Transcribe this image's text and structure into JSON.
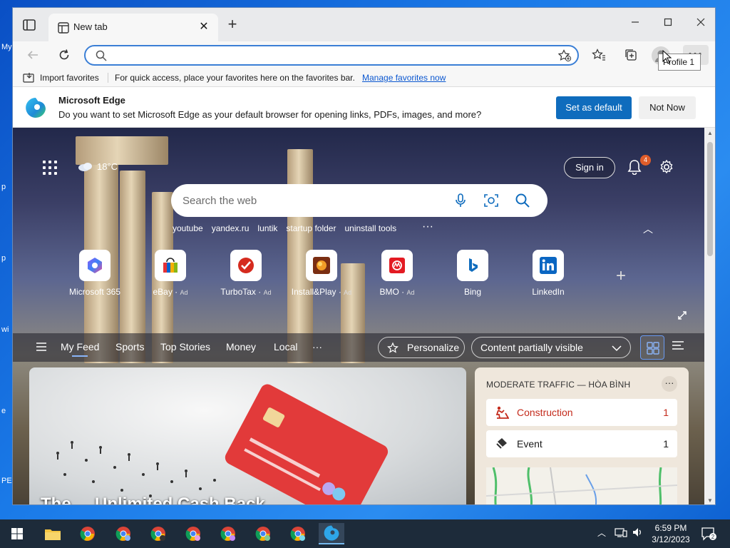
{
  "browser": {
    "tab_title": "New tab",
    "tooltip": "Profile 1"
  },
  "favorites_bar": {
    "import_label": "Import favorites",
    "hint": "For quick access, place your favorites here on the favorites bar.",
    "manage_link": "Manage favorites now"
  },
  "infobar": {
    "title": "Microsoft Edge",
    "message": "Do you want to set Microsoft Edge as your default browser for opening links, PDFs, images, and more?",
    "set_default": "Set as default",
    "not_now": "Not Now"
  },
  "newtab": {
    "weather": "18°C",
    "sign_in": "Sign in",
    "notif_count": "4",
    "search_placeholder": "Search the web",
    "trending": [
      "youtube",
      "yandex.ru",
      "luntik",
      "startup folder",
      "uninstall tools"
    ],
    "quick_links": [
      {
        "label": "Microsoft 365",
        "ad": ""
      },
      {
        "label": "eBay",
        "ad": "Ad"
      },
      {
        "label": "TurboTax",
        "ad": "Ad"
      },
      {
        "label": "Install&Play",
        "ad": "Ad"
      },
      {
        "label": "BMO",
        "ad": "Ad"
      },
      {
        "label": "Bing",
        "ad": ""
      },
      {
        "label": "LinkedIn",
        "ad": ""
      }
    ],
    "feed_tabs": [
      "My Feed",
      "Sports",
      "Top Stories",
      "Money",
      "Local"
    ],
    "personalize": "Personalize",
    "content_visibility": "Content partially visible",
    "headline": "The ... Unlimited Cash Back"
  },
  "traffic": {
    "title": "MODERATE TRAFFIC — HÒA BÌNH",
    "rows": [
      {
        "label": "Construction",
        "count": "1",
        "color": "#c42b1c"
      },
      {
        "label": "Event",
        "count": "1",
        "color": "#1b1b1b"
      }
    ]
  },
  "taskbar": {
    "time": "6:59 PM",
    "date": "3/12/2023",
    "notif_count": "2"
  },
  "colors": {
    "accent": "#0f6cbd",
    "taskbar": "#1d2b3a"
  }
}
